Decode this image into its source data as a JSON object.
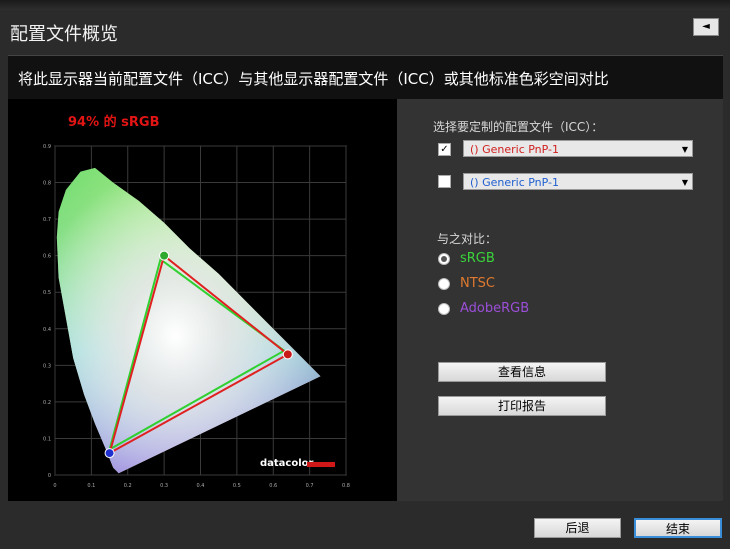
{
  "window": {
    "title": "配置文件概览",
    "corner_icon": "collapse-icon"
  },
  "header": {
    "text": "将此显示器当前配置文件（ICC）与其他显示器配置文件（ICC）或其他标准色彩空间对比"
  },
  "chart": {
    "coverage": "94% 的 sRGB",
    "watermark": "datacolor",
    "axis_x_ticks": [
      "0",
      "0.1",
      "0.2",
      "0.3",
      "0.4",
      "0.5",
      "0.6",
      "0.7",
      "0.8"
    ],
    "axis_y_ticks": [
      "0",
      "0.1",
      "0.2",
      "0.3",
      "0.4",
      "0.5",
      "0.6",
      "0.7",
      "0.8",
      "0.9"
    ]
  },
  "chart_data": {
    "type": "scatter",
    "xlim": [
      0,
      0.8
    ],
    "ylim": [
      0,
      0.9
    ],
    "grid": true,
    "series": [
      {
        "name": "sRGB",
        "color": "#e02020",
        "points": [
          [
            0.64,
            0.33
          ],
          [
            0.3,
            0.6
          ],
          [
            0.15,
            0.06
          ]
        ]
      },
      {
        "name": "",
        "color": "#2fd02f",
        "points": [
          [
            0.63,
            0.34
          ],
          [
            0.29,
            0.59
          ],
          [
            0.15,
            0.07
          ]
        ]
      }
    ]
  },
  "controls": {
    "select_label": "选择要定制的配置文件（ICC）：",
    "profile1": {
      "checked": true,
      "value": "() Generic PnP-1",
      "color": "#d02020"
    },
    "profile2": {
      "checked": false,
      "value": "() Generic PnP-1",
      "color": "#2060d0"
    },
    "compare_label": "与之对比：",
    "options": [
      {
        "label": "sRGB",
        "color": "#3ad43a",
        "selected": true
      },
      {
        "label": "NTSC",
        "color": "#e07a2e",
        "selected": false
      },
      {
        "label": "AdobeRGB",
        "color": "#9b4fd8",
        "selected": false
      }
    ],
    "info_button": "查看信息",
    "print_button": "打印报告"
  },
  "footer": {
    "back": "后退",
    "finish": "结束"
  }
}
